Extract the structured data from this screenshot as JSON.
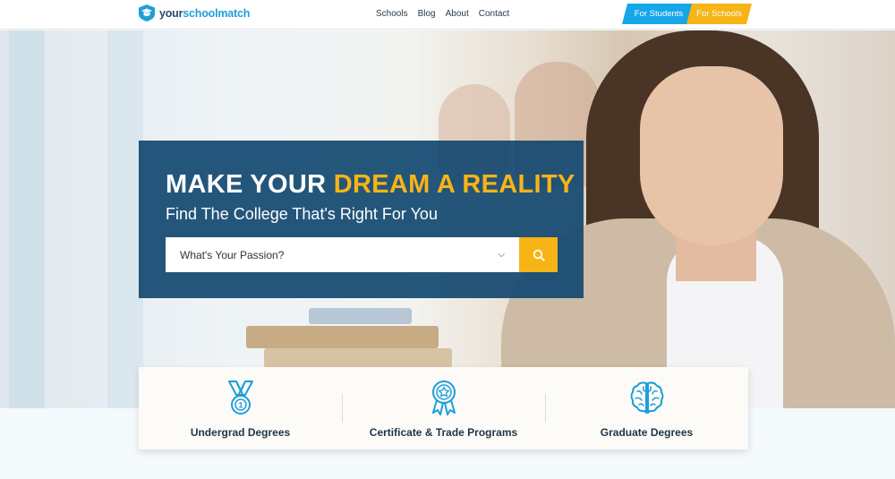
{
  "header": {
    "logo": {
      "part1": "your",
      "part2": "schoolmatch",
      "icon": "graduation-cap-shield-icon"
    },
    "nav": [
      "Schools",
      "Blog",
      "About",
      "Contact"
    ],
    "audience": {
      "students": "For Students",
      "schools": "For Schools"
    }
  },
  "hero": {
    "headline_main": "MAKE YOUR ",
    "headline_accent": "DREAM A REALITY",
    "subheadline": "Find The College That's Right For You",
    "search": {
      "selected": "What's Your Passion?",
      "button_icon": "search-icon"
    }
  },
  "categories": [
    {
      "label": "Undergrad Degrees",
      "icon": "medal-icon"
    },
    {
      "label": "Certificate & Trade Programs",
      "icon": "award-ribbon-icon"
    },
    {
      "label": "Graduate Degrees",
      "icon": "brain-icon"
    }
  ],
  "colors": {
    "primary_blue": "#16a7e8",
    "accent_yellow": "#f6b416",
    "panel_navy": "#124870",
    "dark_text": "#1f3548"
  }
}
